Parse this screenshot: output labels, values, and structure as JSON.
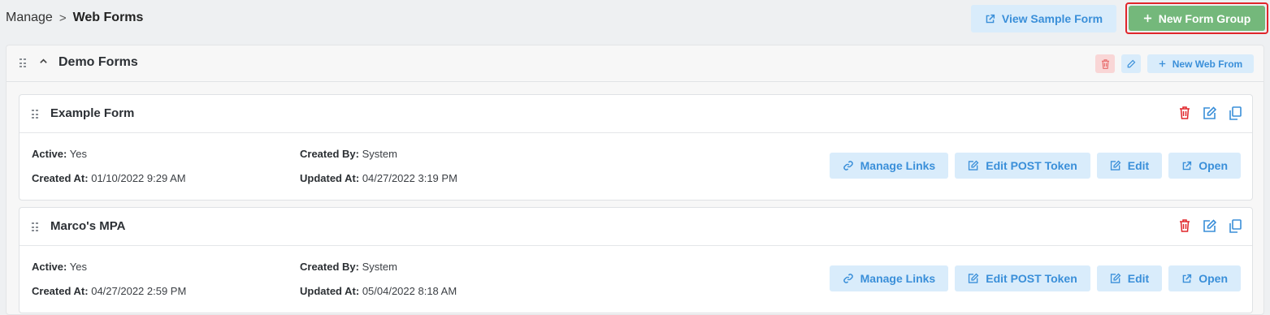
{
  "breadcrumb": {
    "parent": "Manage",
    "separator": ">",
    "current": "Web Forms"
  },
  "header": {
    "view_sample_label": "View Sample Form",
    "new_group_label": "New Form Group"
  },
  "group": {
    "title": "Demo Forms",
    "new_web_form_label": "New Web From"
  },
  "forms": [
    {
      "title": "Example Form",
      "active_label": "Active:",
      "active": "Yes",
      "created_by_label": "Created By:",
      "created_by": "System",
      "created_at_label": "Created At:",
      "created_at": "01/10/2022 9:29 AM",
      "updated_at_label": "Updated At:",
      "updated_at": "04/27/2022 3:19 PM"
    },
    {
      "title": "Marco's MPA",
      "active_label": "Active:",
      "active": "Yes",
      "created_by_label": "Created By:",
      "created_by": "System",
      "created_at_label": "Created At:",
      "created_at": "04/27/2022 2:59 PM",
      "updated_at_label": "Updated At:",
      "updated_at": "05/04/2022 8:18 AM"
    }
  ],
  "actions": {
    "manage_links": "Manage Links",
    "edit_post_token": "Edit POST Token",
    "edit": "Edit",
    "open": "Open"
  },
  "colors": {
    "accent_blue": "#3a8fd9",
    "light_blue": "#d9ecfb",
    "green": "#74b87b",
    "danger": "#e0262b"
  },
  "icons": [
    "external-link-icon",
    "plus-icon",
    "drag-handle-icon",
    "chevron-up-icon",
    "trash-icon",
    "pencil-icon",
    "edit-icon",
    "copy-icon",
    "link-icon"
  ]
}
